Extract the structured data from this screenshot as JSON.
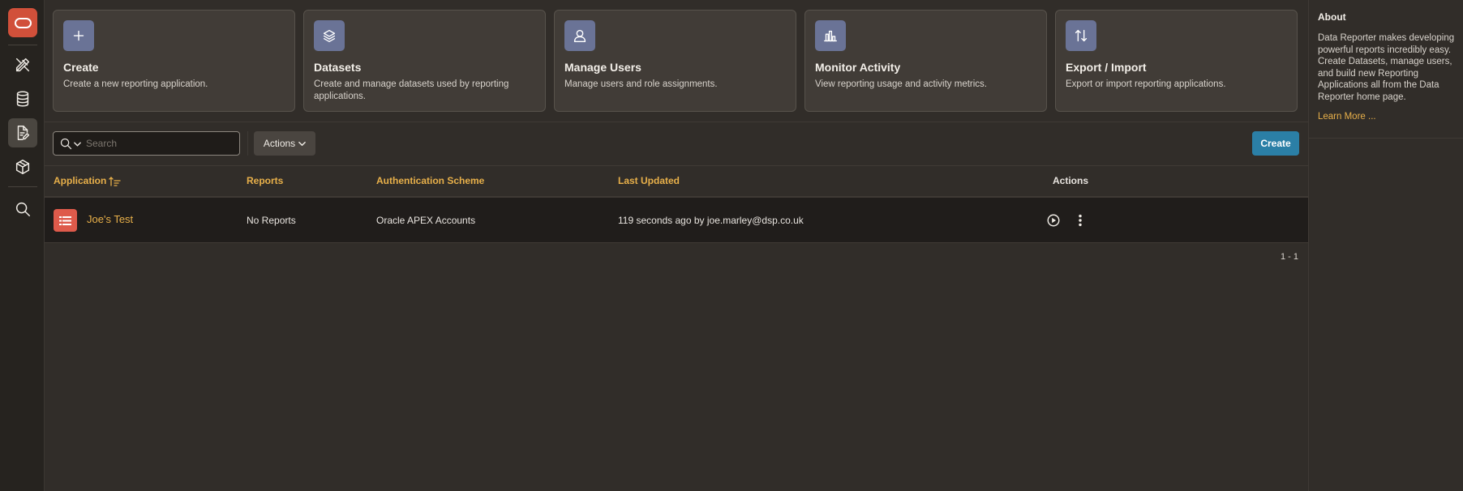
{
  "brand": {
    "accent": "#d1503a",
    "link": "#e8b04a",
    "primary": "#2b7fa6"
  },
  "nav": {
    "items": [
      {
        "name": "app-builder",
        "icon": "pencil-ruler-icon"
      },
      {
        "name": "datasets",
        "icon": "database-icon"
      },
      {
        "name": "reporting-apps",
        "icon": "document-edit-icon",
        "active": true
      },
      {
        "name": "packages",
        "icon": "box-icon"
      },
      {
        "name": "search",
        "icon": "search-icon"
      }
    ]
  },
  "cards": [
    {
      "title": "Create",
      "description": "Create a new reporting application.",
      "icon": "plus-icon"
    },
    {
      "title": "Datasets",
      "description": "Create and manage datasets used by reporting applications.",
      "icon": "layers-icon"
    },
    {
      "title": "Manage Users",
      "description": "Manage users and role assignments.",
      "icon": "user-icon"
    },
    {
      "title": "Monitor Activity",
      "description": "View reporting usage and activity metrics.",
      "icon": "bar-chart-icon"
    },
    {
      "title": "Export / Import",
      "description": "Export or import reporting applications.",
      "icon": "arrows-updown-icon"
    }
  ],
  "toolbar": {
    "search_placeholder": "Search",
    "actions_label": "Actions",
    "create_label": "Create"
  },
  "table": {
    "columns": [
      "Application",
      "Reports",
      "Authentication Scheme",
      "Last Updated",
      "Actions"
    ],
    "rows": [
      {
        "application": "Joe's Test",
        "reports": "No Reports",
        "auth_scheme": "Oracle APEX Accounts",
        "last_updated": "119 seconds ago by joe.marley@dsp.co.uk"
      }
    ],
    "pagination": "1 - 1"
  },
  "about": {
    "title": "About",
    "text": "Data Reporter makes developing powerful reports incredibly easy. Create Datasets, manage users, and build new Reporting Applications all from the Data Reporter home page.",
    "link": "Learn More ..."
  }
}
